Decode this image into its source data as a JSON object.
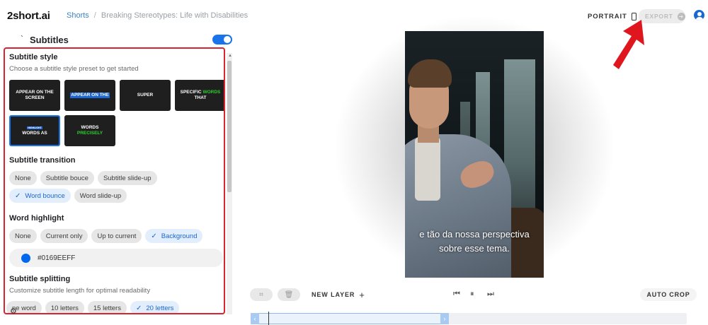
{
  "app": {
    "logo": "2short.ai"
  },
  "breadcrumb": {
    "link": "Shorts",
    "separator": "/",
    "current": "Breaking Stereotypes: Life with Disabilities"
  },
  "header": {
    "portrait_label": "PORTRAIT",
    "export_label": "EXPORT"
  },
  "panel": {
    "caret": "`",
    "title": "Subtitles",
    "toggle_on": true,
    "subtitle_style": {
      "title": "Subtitle style",
      "description": "Choose a subtitle style preset to get started",
      "presets": [
        {
          "line1": "APPEAR ON THE",
          "line2": "SCREEN",
          "style": "plain"
        },
        {
          "line1": "APPEAR ON THE",
          "line2": "",
          "style": "blue-highlight"
        },
        {
          "line1": "SUPER",
          "line2": "",
          "style": "plain"
        },
        {
          "line1": "SPECIFIC",
          "highlight": "WORDS",
          "line2": "THAT",
          "style": "green-word"
        },
        {
          "line1": "HIGHLIGHT",
          "line2": "WORDS AS",
          "style": "selected"
        },
        {
          "line1": "WORDS",
          "line2": "PRECISELY",
          "style": "green-line"
        }
      ]
    },
    "subtitle_transition": {
      "title": "Subtitle transition",
      "options": [
        "None",
        "Subtitle bouce",
        "Subtitle slide-up",
        "Word bounce",
        "Word slide-up"
      ],
      "selected": "Word bounce"
    },
    "word_highlight": {
      "title": "Word highlight",
      "options": [
        "None",
        "Current only",
        "Up to current",
        "Background"
      ],
      "selected": "Background",
      "color_value": "#0169EEFF",
      "color": "#0169EE"
    },
    "subtitle_splitting": {
      "title": "Subtitle splitting",
      "description": "Customize subtitle length for optimal readability",
      "options": [
        "ne word",
        "10 letters",
        "15 letters",
        "20 letters"
      ],
      "selected": "20 letters"
    }
  },
  "preview": {
    "subtitle_line1": "e tão da nossa perspectiva",
    "subtitle_line2": "sobre esse tema."
  },
  "controls": {
    "new_layer_label": "NEW LAYER",
    "auto_crop_label": "AUTO CROP"
  },
  "colors": {
    "accent": "#1a73e8",
    "annotation": "#e0161f"
  }
}
